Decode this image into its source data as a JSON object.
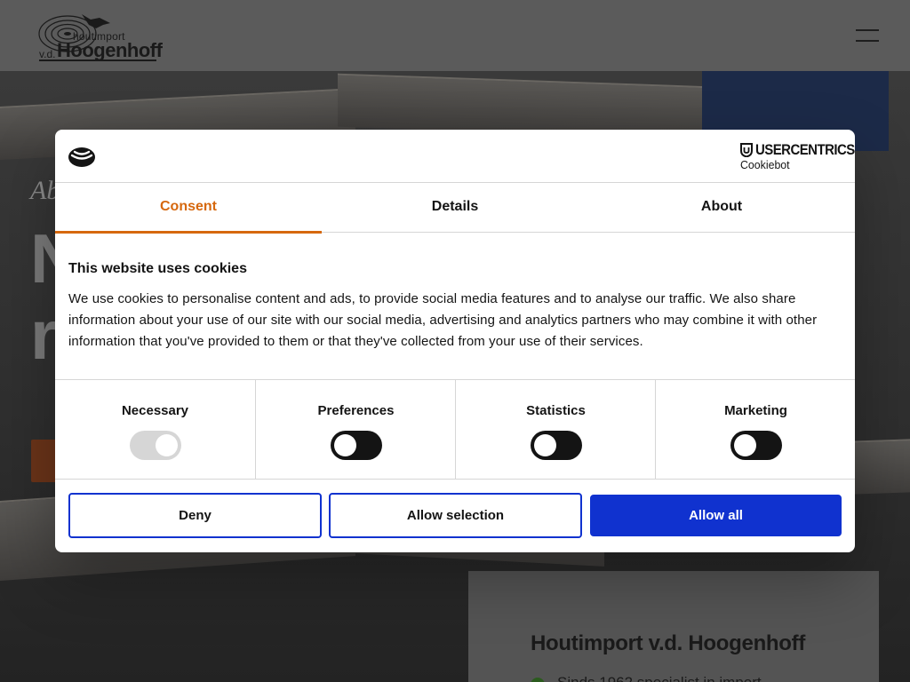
{
  "site": {
    "logo": {
      "small_text": "houtimport",
      "prefix": "v.d.",
      "name": "Hoogenhoff"
    },
    "hero": {
      "eyebrow": "Ab",
      "title_line1": "N",
      "title_line2": "r"
    },
    "info_card": {
      "title": "Houtimport v.d. Hoogenhoff",
      "bullet_text": "Sinds 1962 specialist in import"
    }
  },
  "cookie_dialog": {
    "brand": {
      "provider_name": "USERCENTRICS",
      "product_name": "Cookiebot"
    },
    "tabs": [
      {
        "label": "Consent",
        "active": true
      },
      {
        "label": "Details",
        "active": false
      },
      {
        "label": "About",
        "active": false
      }
    ],
    "heading": "This website uses cookies",
    "body_text": "We use cookies to personalise content and ads, to provide social media features and to analyse our traffic. We also share information about your use of our site with our social media, advertising and analytics partners who may combine it with other information that you've provided to them or that they've collected from your use of their services.",
    "toggles": [
      {
        "label": "Necessary",
        "checked": true,
        "disabled": true
      },
      {
        "label": "Preferences",
        "checked": false,
        "disabled": false
      },
      {
        "label": "Statistics",
        "checked": false,
        "disabled": false
      },
      {
        "label": "Marketing",
        "checked": false,
        "disabled": false
      }
    ],
    "buttons": {
      "deny": "Deny",
      "allow_selection": "Allow selection",
      "allow_all": "Allow all"
    }
  },
  "colors": {
    "accent_orange": "#d6680e",
    "button_blue": "#1032cf",
    "switch_dark": "#141414"
  },
  "icons": {
    "header_brand": "cookiebot-logo-icon",
    "usercentrics": "shield-icon",
    "menu": "hamburger-menu-icon"
  }
}
